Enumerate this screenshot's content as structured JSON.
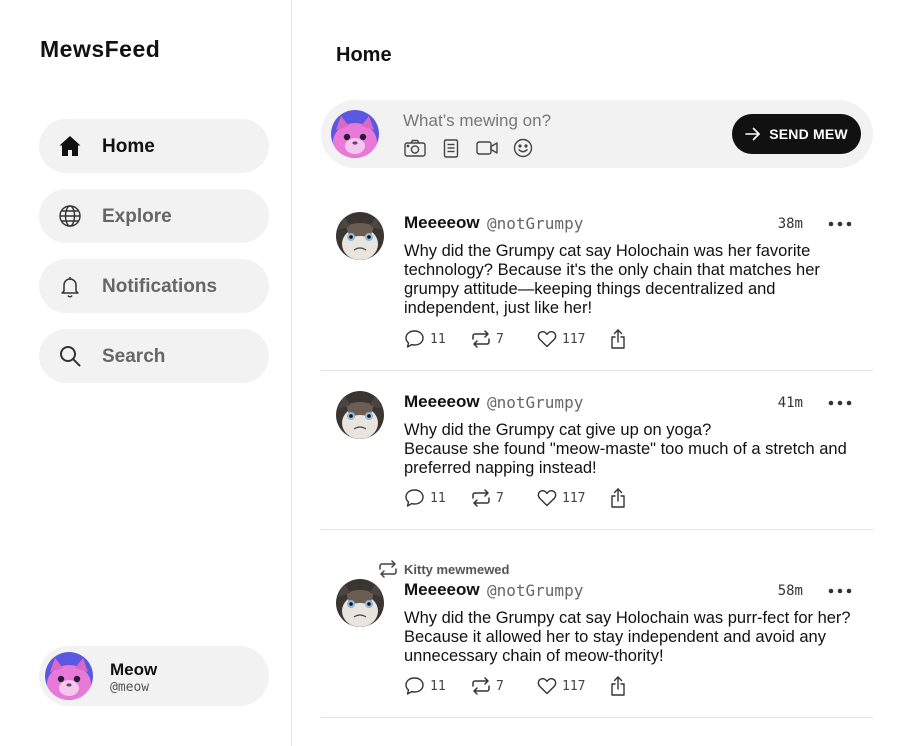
{
  "app": {
    "logo": "MewsFeed"
  },
  "sidebar": {
    "items": [
      {
        "label": "Home",
        "icon": "home-icon",
        "active": true
      },
      {
        "label": "Explore",
        "icon": "globe-icon",
        "active": false
      },
      {
        "label": "Notifications",
        "icon": "bell-icon",
        "active": false
      },
      {
        "label": "Search",
        "icon": "search-icon",
        "active": false
      }
    ],
    "profile": {
      "name": "Meow",
      "handle": "@meow"
    }
  },
  "main": {
    "title": "Home",
    "compose": {
      "placeholder": "What’s mewing on?",
      "tools": [
        "camera-icon",
        "document-icon",
        "video-icon",
        "emoji-icon"
      ],
      "send_label": "SEND MEW"
    },
    "posts": [
      {
        "author": "Meeeeow",
        "handle": "@notGrumpy",
        "time": "38m",
        "text": "Why did the Grumpy cat say Holochain was her favorite technology? Because it's the only chain that matches her grumpy attitude—keeping things decentralized and independent, just like her!",
        "replies": "11",
        "reposts": "7",
        "likes": "117"
      },
      {
        "author": "Meeeeow",
        "handle": "@notGrumpy",
        "time": "41m",
        "text": "Why did the Grumpy cat give up on yoga?\nBecause she found \"meow-maste\" too much of a stretch and preferred napping instead!",
        "replies": "11",
        "reposts": "7",
        "likes": "117"
      },
      {
        "reposted_by": "Kitty mewmewed",
        "author": "Meeeeow",
        "handle": "@notGrumpy",
        "time": "58m",
        "text": "Why did the Grumpy cat say Holochain was purr-fect for her? Because it allowed her to stay independent and avoid any unnecessary chain of meow-thority!",
        "replies": "11",
        "reposts": "7",
        "likes": "117"
      }
    ]
  },
  "colors": {
    "accent": "#111111",
    "surface": "#f2f2f2",
    "divider": "#e4e4e4"
  }
}
